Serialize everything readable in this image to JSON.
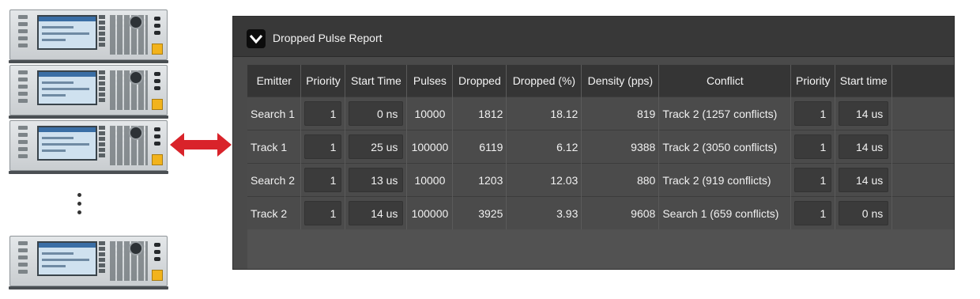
{
  "panel": {
    "title": "Dropped Pulse Report"
  },
  "table": {
    "headers": {
      "emitter": "Emitter",
      "priority": "Priority",
      "start_time": "Start Time",
      "pulses": "Pulses",
      "dropped": "Dropped",
      "dropped_pct": "Dropped (%)",
      "density": "Density (pps)",
      "conflict": "Conflict",
      "conflict_priority": "Priority",
      "conflict_start_time": "Start time"
    },
    "rows": [
      {
        "emitter": "Search 1",
        "priority": "1",
        "start_time": "0 ns",
        "pulses": "10000",
        "dropped": "1812",
        "dropped_pct": "18.12",
        "density": "819",
        "conflict": "Track 2 (1257 conflicts)",
        "conflict_priority": "1",
        "conflict_start_time": "14 us"
      },
      {
        "emitter": "Track 1",
        "priority": "1",
        "start_time": "25 us",
        "pulses": "100000",
        "dropped": "6119",
        "dropped_pct": "6.12",
        "density": "9388",
        "conflict": "Track 2 (3050 conflicts)",
        "conflict_priority": "1",
        "conflict_start_time": "14 us"
      },
      {
        "emitter": "Search 2",
        "priority": "1",
        "start_time": "13 us",
        "pulses": "10000",
        "dropped": "1203",
        "dropped_pct": "12.03",
        "density": "880",
        "conflict": "Track 2 (919 conflicts)",
        "conflict_priority": "1",
        "conflict_start_time": "14 us"
      },
      {
        "emitter": "Track 2",
        "priority": "1",
        "start_time": "14 us",
        "pulses": "100000",
        "dropped": "3925",
        "dropped_pct": "3.93",
        "density": "9608",
        "conflict": "Search 1 (659 conflicts)",
        "conflict_priority": "1",
        "conflict_start_time": "0 ns"
      }
    ]
  },
  "colors": {
    "arrow": "#d9232a",
    "panel_bg": "#4a4a4a",
    "header_bg": "#353535"
  },
  "icons": {
    "collapse": "chevron-down-icon",
    "link_arrow": "double-arrow-icon"
  }
}
